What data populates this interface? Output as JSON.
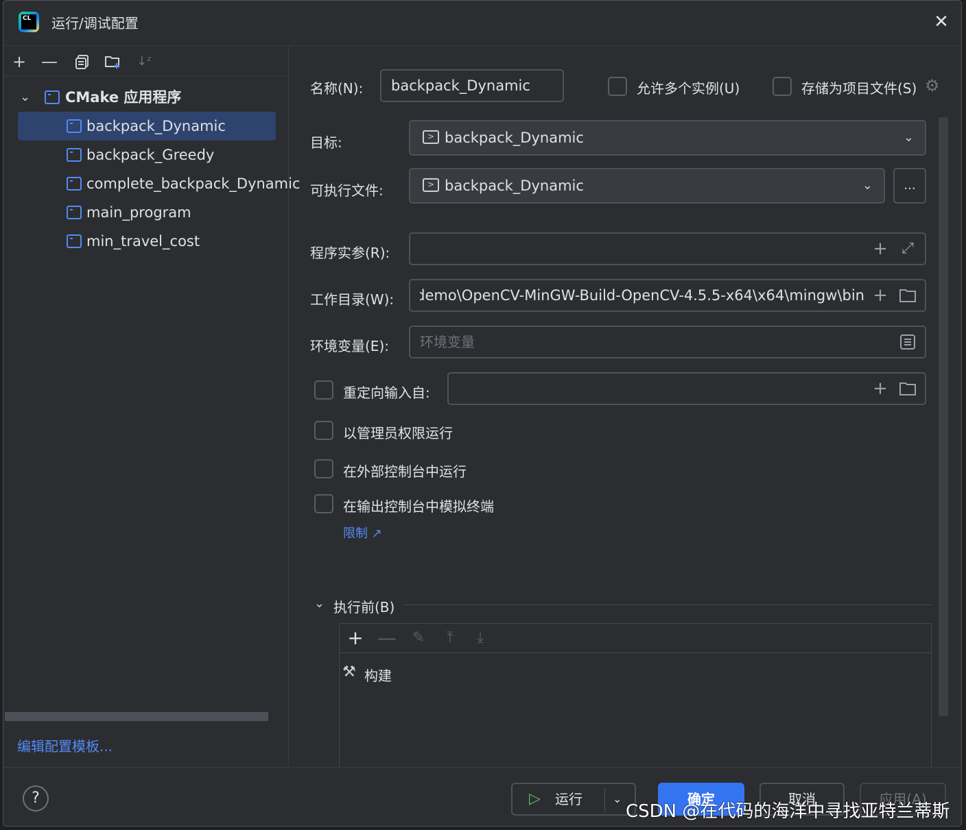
{
  "window": {
    "title": "运行/调试配置"
  },
  "left_toolbar": {
    "icons": [
      "add-icon",
      "remove-icon",
      "copy-icon",
      "new-folder-icon",
      "sort-icon"
    ]
  },
  "tree": {
    "group_label": "CMake 应用程序",
    "items": [
      {
        "label": "backpack_Dynamic",
        "selected": true
      },
      {
        "label": "backpack_Greedy"
      },
      {
        "label": "complete_backpack_Dynamic"
      },
      {
        "label": "main_program"
      },
      {
        "label": "min_travel_cost"
      }
    ]
  },
  "edit_templates_link": "编辑配置模板...",
  "form": {
    "name_label": "名称(N):",
    "name_value": "backpack_Dynamic",
    "allow_multiple_label": "允许多个实例(U)",
    "store_as_file_label": "存储为项目文件(S)",
    "target_label": "目标:",
    "target_value": "backpack_Dynamic",
    "executable_label": "可执行文件:",
    "executable_value": "backpack_Dynamic",
    "browse_label": "...",
    "program_args_label": "程序实参(R):",
    "program_args_value": "",
    "workdir_label": "工作目录(W):",
    "workdir_value": "demo\\OpenCV-MinGW-Build-OpenCV-4.5.5-x64\\x64\\mingw\\bin",
    "env_label": "环境变量(E):",
    "env_placeholder": "环境变量",
    "redirect_label": "重定向输入自:",
    "run_as_admin_label": "以管理员权限运行",
    "external_console_label": "在外部控制台中运行",
    "emulate_terminal_label": "在输出控制台中模拟终端",
    "limit_link": "限制 ↗"
  },
  "before_launch": {
    "header": "执行前(B)",
    "tasks": [
      "构建"
    ]
  },
  "buttons": {
    "run": "运行",
    "ok": "确定",
    "cancel": "取消",
    "apply": "应用(A)",
    "help": "?"
  },
  "watermark": "CSDN @在代码的海洋中寻找亚特兰蒂斯",
  "colors": {
    "accent": "#3574f0",
    "selection": "#2e436e",
    "link": "#548af7",
    "background": "#2b2d30"
  }
}
